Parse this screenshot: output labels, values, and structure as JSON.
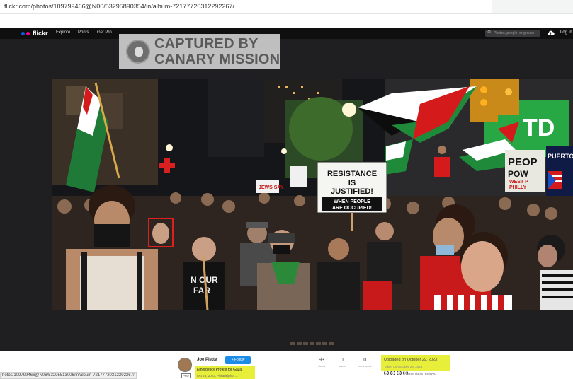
{
  "browser": {
    "url": "flickr.com/photos/109799466@N06/53295890354/in/album-72177720312292267/",
    "status_url": "hotos/109799466@N06/53295513006/in/album-72177720312292267/"
  },
  "flickr_nav": {
    "logo": "flickr",
    "explore": "Explore",
    "prints": "Prints",
    "get_pro": "Get Pro",
    "search_placeholder": "Photos, people, or groups",
    "login": "Log In"
  },
  "watermark": {
    "line1": "CAPTURED BY",
    "line2": "CANARY MISSION"
  },
  "photo_signs": {
    "main_line1": "RESISTANCE",
    "main_line2": "IS",
    "main_line3": "JUSTIFIED!",
    "main_line4": "WHEN PEOPLE",
    "main_line5": "ARE OCCUPIED!",
    "left_sign": "JEWS SAY",
    "right_sign1": "PEOP",
    "right_sign2": "POW",
    "right_sign3": "WEST P",
    "right_sign4": "PHILLY",
    "far_right": "PUERTO",
    "shirt_line1": "N OUR",
    "shirt_line2": "FAR",
    "store_sign": "TD"
  },
  "footer": {
    "author": "Joe Piette",
    "pro_badge": "PRO",
    "follow_label": "+ Follow",
    "photo_title": "Emergency Protest for Gaza,",
    "photo_date_line": "Oct 28, 2023, Philadelphia ...",
    "stats": [
      {
        "value": "93",
        "label": "views"
      },
      {
        "value": "0",
        "label": "faves"
      },
      {
        "value": "0",
        "label": "comments"
      }
    ],
    "uploaded": "Uploaded on October 29, 2023",
    "taken": "Taken on October 28, 2023",
    "license_icons": [
      "cc",
      "by",
      "nc",
      "sa"
    ],
    "rights": "Some rights reserved"
  },
  "colors": {
    "flickr_blue": "#0063dc",
    "flickr_pink": "#ff0084",
    "follow_blue": "#1c8ce6",
    "highlight_yellow": "#e8ef3a",
    "face_box_red": "#e02020"
  }
}
